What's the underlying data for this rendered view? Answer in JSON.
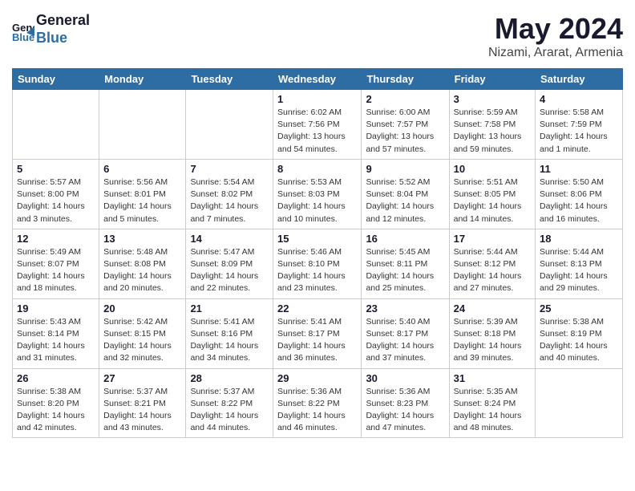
{
  "header": {
    "logo_line1": "General",
    "logo_line2": "Blue",
    "title": "May 2024",
    "subtitle": "Nizami, Ararat, Armenia"
  },
  "columns": [
    "Sunday",
    "Monday",
    "Tuesday",
    "Wednesday",
    "Thursday",
    "Friday",
    "Saturday"
  ],
  "weeks": [
    [
      {
        "day": "",
        "info": ""
      },
      {
        "day": "",
        "info": ""
      },
      {
        "day": "",
        "info": ""
      },
      {
        "day": "1",
        "info": "Sunrise: 6:02 AM\nSunset: 7:56 PM\nDaylight: 13 hours\nand 54 minutes."
      },
      {
        "day": "2",
        "info": "Sunrise: 6:00 AM\nSunset: 7:57 PM\nDaylight: 13 hours\nand 57 minutes."
      },
      {
        "day": "3",
        "info": "Sunrise: 5:59 AM\nSunset: 7:58 PM\nDaylight: 13 hours\nand 59 minutes."
      },
      {
        "day": "4",
        "info": "Sunrise: 5:58 AM\nSunset: 7:59 PM\nDaylight: 14 hours\nand 1 minute."
      }
    ],
    [
      {
        "day": "5",
        "info": "Sunrise: 5:57 AM\nSunset: 8:00 PM\nDaylight: 14 hours\nand 3 minutes."
      },
      {
        "day": "6",
        "info": "Sunrise: 5:56 AM\nSunset: 8:01 PM\nDaylight: 14 hours\nand 5 minutes."
      },
      {
        "day": "7",
        "info": "Sunrise: 5:54 AM\nSunset: 8:02 PM\nDaylight: 14 hours\nand 7 minutes."
      },
      {
        "day": "8",
        "info": "Sunrise: 5:53 AM\nSunset: 8:03 PM\nDaylight: 14 hours\nand 10 minutes."
      },
      {
        "day": "9",
        "info": "Sunrise: 5:52 AM\nSunset: 8:04 PM\nDaylight: 14 hours\nand 12 minutes."
      },
      {
        "day": "10",
        "info": "Sunrise: 5:51 AM\nSunset: 8:05 PM\nDaylight: 14 hours\nand 14 minutes."
      },
      {
        "day": "11",
        "info": "Sunrise: 5:50 AM\nSunset: 8:06 PM\nDaylight: 14 hours\nand 16 minutes."
      }
    ],
    [
      {
        "day": "12",
        "info": "Sunrise: 5:49 AM\nSunset: 8:07 PM\nDaylight: 14 hours\nand 18 minutes."
      },
      {
        "day": "13",
        "info": "Sunrise: 5:48 AM\nSunset: 8:08 PM\nDaylight: 14 hours\nand 20 minutes."
      },
      {
        "day": "14",
        "info": "Sunrise: 5:47 AM\nSunset: 8:09 PM\nDaylight: 14 hours\nand 22 minutes."
      },
      {
        "day": "15",
        "info": "Sunrise: 5:46 AM\nSunset: 8:10 PM\nDaylight: 14 hours\nand 23 minutes."
      },
      {
        "day": "16",
        "info": "Sunrise: 5:45 AM\nSunset: 8:11 PM\nDaylight: 14 hours\nand 25 minutes."
      },
      {
        "day": "17",
        "info": "Sunrise: 5:44 AM\nSunset: 8:12 PM\nDaylight: 14 hours\nand 27 minutes."
      },
      {
        "day": "18",
        "info": "Sunrise: 5:44 AM\nSunset: 8:13 PM\nDaylight: 14 hours\nand 29 minutes."
      }
    ],
    [
      {
        "day": "19",
        "info": "Sunrise: 5:43 AM\nSunset: 8:14 PM\nDaylight: 14 hours\nand 31 minutes."
      },
      {
        "day": "20",
        "info": "Sunrise: 5:42 AM\nSunset: 8:15 PM\nDaylight: 14 hours\nand 32 minutes."
      },
      {
        "day": "21",
        "info": "Sunrise: 5:41 AM\nSunset: 8:16 PM\nDaylight: 14 hours\nand 34 minutes."
      },
      {
        "day": "22",
        "info": "Sunrise: 5:41 AM\nSunset: 8:17 PM\nDaylight: 14 hours\nand 36 minutes."
      },
      {
        "day": "23",
        "info": "Sunrise: 5:40 AM\nSunset: 8:17 PM\nDaylight: 14 hours\nand 37 minutes."
      },
      {
        "day": "24",
        "info": "Sunrise: 5:39 AM\nSunset: 8:18 PM\nDaylight: 14 hours\nand 39 minutes."
      },
      {
        "day": "25",
        "info": "Sunrise: 5:38 AM\nSunset: 8:19 PM\nDaylight: 14 hours\nand 40 minutes."
      }
    ],
    [
      {
        "day": "26",
        "info": "Sunrise: 5:38 AM\nSunset: 8:20 PM\nDaylight: 14 hours\nand 42 minutes."
      },
      {
        "day": "27",
        "info": "Sunrise: 5:37 AM\nSunset: 8:21 PM\nDaylight: 14 hours\nand 43 minutes."
      },
      {
        "day": "28",
        "info": "Sunrise: 5:37 AM\nSunset: 8:22 PM\nDaylight: 14 hours\nand 44 minutes."
      },
      {
        "day": "29",
        "info": "Sunrise: 5:36 AM\nSunset: 8:22 PM\nDaylight: 14 hours\nand 46 minutes."
      },
      {
        "day": "30",
        "info": "Sunrise: 5:36 AM\nSunset: 8:23 PM\nDaylight: 14 hours\nand 47 minutes."
      },
      {
        "day": "31",
        "info": "Sunrise: 5:35 AM\nSunset: 8:24 PM\nDaylight: 14 hours\nand 48 minutes."
      },
      {
        "day": "",
        "info": ""
      }
    ]
  ]
}
